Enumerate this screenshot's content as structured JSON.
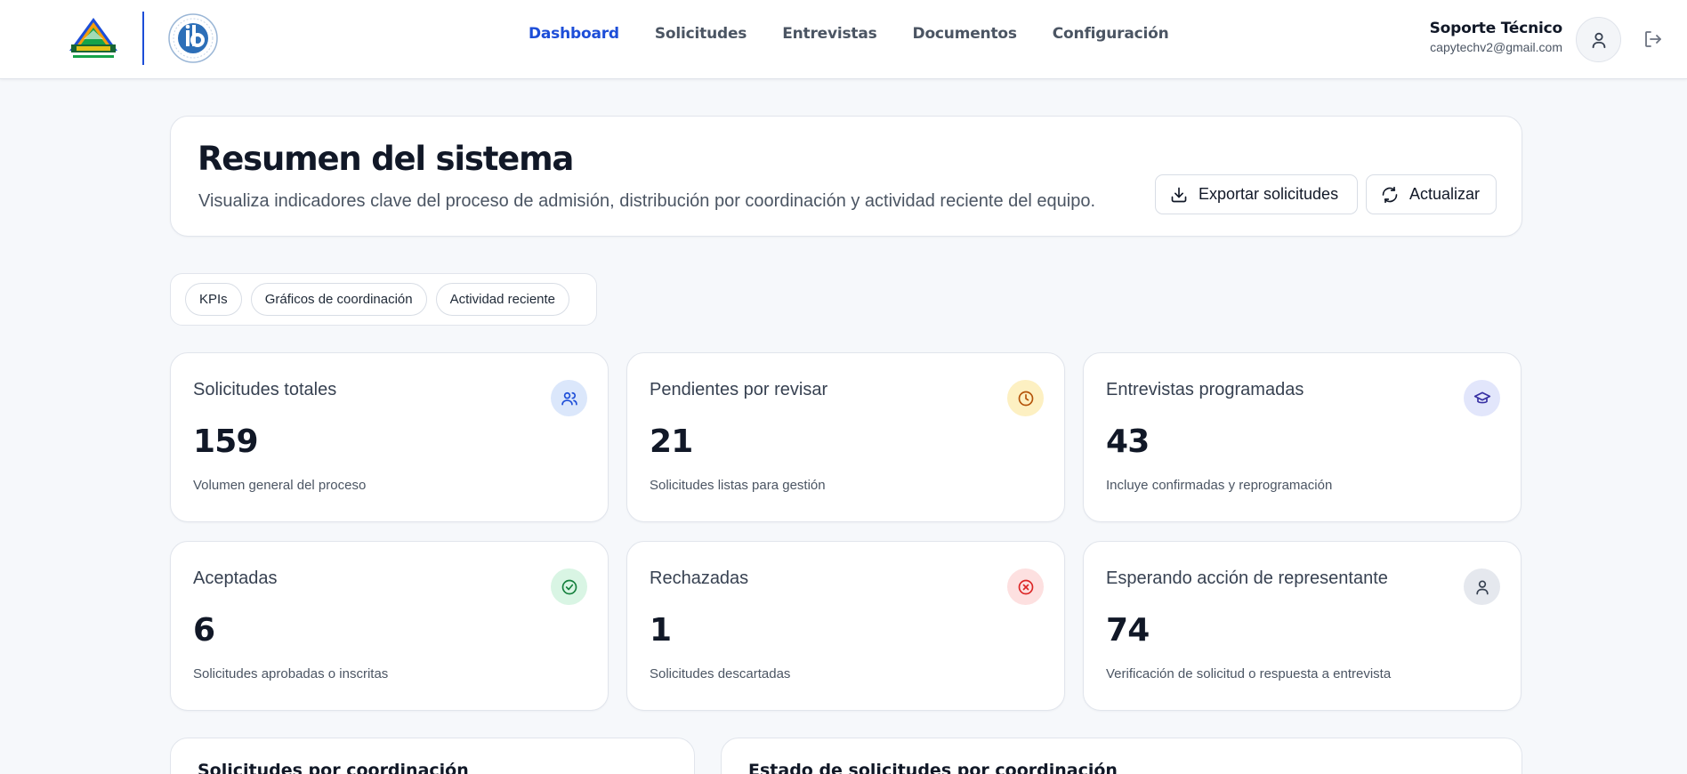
{
  "header": {
    "nav": [
      {
        "label": "Dashboard",
        "active": true
      },
      {
        "label": "Solicitudes",
        "active": false
      },
      {
        "label": "Entrevistas",
        "active": false
      },
      {
        "label": "Documentos",
        "active": false
      },
      {
        "label": "Configuración",
        "active": false
      }
    ],
    "user": {
      "name": "Soporte Técnico",
      "email": "capytechv2@gmail.com"
    },
    "icons": {
      "school_logo": "school-logo",
      "ib_logo": "ib-logo",
      "avatar": "user-icon",
      "logout": "logout-icon"
    }
  },
  "hero": {
    "title": "Resumen del sistema",
    "subtitle": "Visualiza indicadores clave del proceso de admisión, distribución por coordinación y actividad reciente del equipo.",
    "export_label": "Exportar solicitudes",
    "refresh_label": "Actualizar"
  },
  "filters": {
    "chips": [
      "KPIs",
      "Gráficos de coordinación",
      "Actividad reciente"
    ]
  },
  "kpis": [
    {
      "label": "Solicitudes totales",
      "value": "159",
      "desc": "Volumen general del proceso",
      "icon": "users-icon",
      "icon_bg": "#dbe7fb",
      "icon_color": "#1d4ed8"
    },
    {
      "label": "Pendientes por revisar",
      "value": "21",
      "desc": "Solicitudes listas para gestión",
      "icon": "clock-icon",
      "icon_bg": "#fdf0c2",
      "icon_color": "#b45309"
    },
    {
      "label": "Entrevistas programadas",
      "value": "43",
      "desc": "Incluye confirmadas y reprogramación",
      "icon": "graduation-cap-icon",
      "icon_bg": "#e2e6fb",
      "icon_color": "#3730a3"
    },
    {
      "label": "Aceptadas",
      "value": "6",
      "desc": "Solicitudes aprobadas o inscritas",
      "icon": "check-circle-icon",
      "icon_bg": "#d9f5e4",
      "icon_color": "#15803d"
    },
    {
      "label": "Rechazadas",
      "value": "1",
      "desc": "Solicitudes descartadas",
      "icon": "x-circle-icon",
      "icon_bg": "#fde0e0",
      "icon_color": "#dc2626"
    },
    {
      "label": "Esperando acción de representante",
      "value": "74",
      "desc": "Verificación de solicitud o respuesta a entrevista",
      "icon": "user-icon",
      "icon_bg": "#e5e8ee",
      "icon_color": "#374151"
    }
  ],
  "panels": {
    "left_title": "Solicitudes por coordinación",
    "right_title": "Estado de solicitudes por coordinación"
  },
  "colors": {
    "accent": "#1d4ed8",
    "page_bg": "#f6f8fb"
  }
}
